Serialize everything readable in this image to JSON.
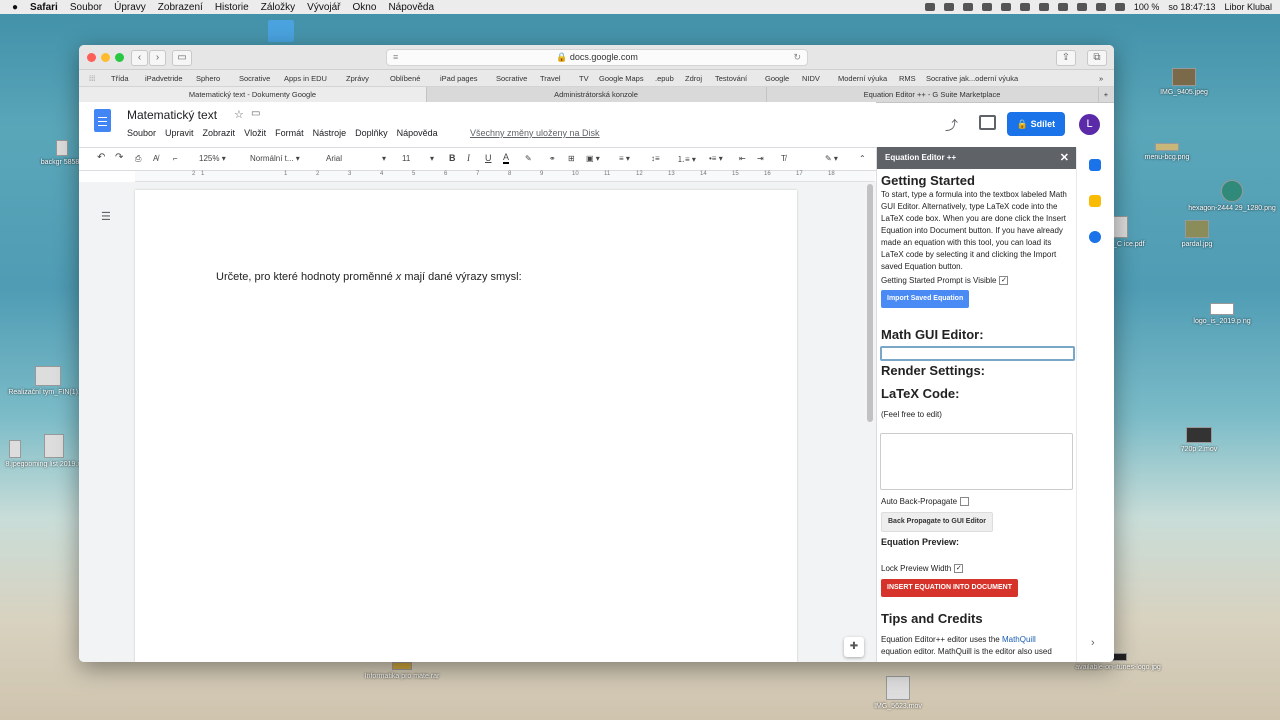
{
  "menubar": {
    "app": "Safari",
    "items": [
      "Soubor",
      "Úpravy",
      "Zobrazení",
      "Historie",
      "Záložky",
      "Vývojář",
      "Okno",
      "Nápověda"
    ],
    "battery": "100 %",
    "clock": "so 18:47:13",
    "user": "Libor Klubal"
  },
  "desktop": {
    "icons": [
      "IMG_9405.jpeg",
      "menu-bcg.png",
      "hexagon-2444 29_1280.png",
      "pardal.jpg",
      "rence_C ice.pdf",
      "logo_is_2019.p ng",
      "720p 2.mov",
      "available-on-itunes-logo.jpg",
      "IMG_5623.mov",
      "Informatika pro mate.rar",
      "Realizační tym_FIN(1).pd",
      "rooming list 2019.xls",
      "backgr 58587",
      "8.jpeg"
    ]
  },
  "browser": {
    "url": "docs.google.com",
    "favorites": [
      "Třída",
      "iPadvetride",
      "Sphero",
      "Socrative",
      "Apps in EDU",
      "Zprávy",
      "Oblíbené",
      "iPad pages",
      "Socrative",
      "Travel",
      "TV",
      "Google Maps",
      ".epub",
      "Zdroj",
      "Testování",
      "Google",
      "NIDV",
      "Moderní výuka",
      "RMS",
      "Socrative jak...oderní výuka"
    ],
    "tabs": [
      "Matematický text - Dokumenty Google",
      "Administrátorská konzole",
      "Equation Editor ++ - G Suite Marketplace"
    ]
  },
  "doc": {
    "title": "Matematický text",
    "menu": [
      "Soubor",
      "Upravit",
      "Zobrazit",
      "Vložit",
      "Formát",
      "Nástroje",
      "Doplňky",
      "Nápověda"
    ],
    "saved": "Všechny změny uloženy na Disk",
    "share": "Sdílet",
    "avatar": "L",
    "zoom": "125%",
    "style": "Normální t...",
    "font": "Arial",
    "size": "11",
    "text_before": "Určete, pro které hodnoty proměnné ",
    "text_var": "x",
    "text_after": " mají dané výrazy smysl:"
  },
  "ruler": [
    "2",
    "1",
    "1",
    "2",
    "3",
    "4",
    "5",
    "6",
    "7",
    "8",
    "9",
    "10",
    "11",
    "12",
    "13",
    "14",
    "15",
    "16",
    "17",
    "18"
  ],
  "sidebar": {
    "title": "Equation Editor ++",
    "gs_heading": "Getting Started",
    "gs_text": "To start, type a formula into the textbox labeled Math GUI Editor. Alternatively, type LaTeX code into the LaTeX code box. When you are done click the Insert Equation into Document button. If you have already made an equation with this tool, you can load its LaTeX code by selecting it and clicking the Import saved Equation button.",
    "gs_visible": "Getting Started Prompt is Visible",
    "import_btn": "Import Saved Equation",
    "gui_heading": "Math GUI Editor:",
    "render_heading": "Render Settings:",
    "latex_heading": "LaTeX Code:",
    "latex_note": "(Feel free to edit)",
    "auto_back": "Auto Back-Propagate",
    "back_btn": "Back Propagate to GUI Editor",
    "preview_heading": "Equation Preview:",
    "lock_width": "Lock Preview Width",
    "insert_btn": "INSERT EQUATION INTO DOCUMENT",
    "tips_heading": "Tips and Credits",
    "tips_1": "Equation Editor++ editor uses the ",
    "tips_link": "MathQuill",
    "tips_2": "equation editor. MathQuill is the editor also used"
  }
}
